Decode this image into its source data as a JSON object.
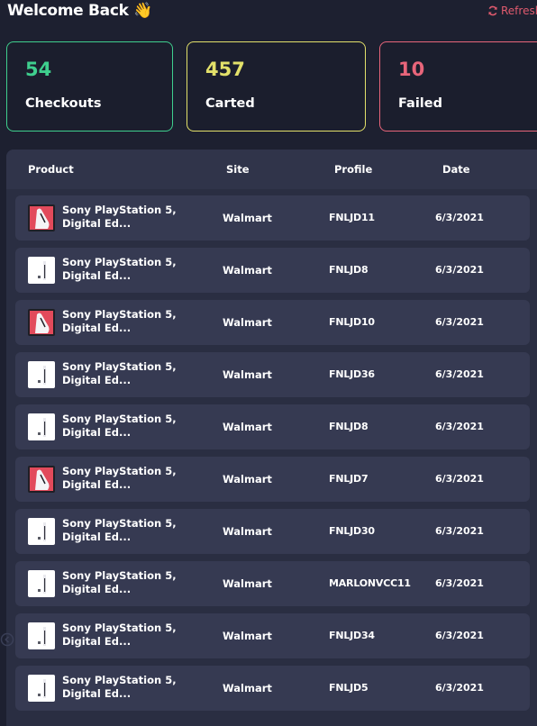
{
  "header": {
    "welcome": "Welcome Back 👋",
    "refresh_label": "Refresh",
    "refresh_icon": "refresh-icon"
  },
  "stats": {
    "checkouts": {
      "value": "54",
      "label": "Checkouts",
      "color": "#3fcf8e"
    },
    "carted": {
      "value": "457",
      "label": "Carted",
      "color": "#e3e16a"
    },
    "failed": {
      "value": "10",
      "label": "Failed",
      "color": "#e8657a"
    }
  },
  "table": {
    "columns": [
      "Product",
      "Site",
      "Profile",
      "Date"
    ],
    "rows": [
      {
        "product": "Sony PlayStation 5, Digital Ed...",
        "site": "Walmart",
        "profile": "FNLJD11",
        "date": "6/3/2021",
        "thumb": "red-console-thumb"
      },
      {
        "product": "Sony PlayStation 5, Digital Ed...",
        "site": "Walmart",
        "profile": "FNLJD8",
        "date": "6/3/2021",
        "thumb": "white-console-thumb"
      },
      {
        "product": "Sony PlayStation 5, Digital Ed...",
        "site": "Walmart",
        "profile": "FNLJD10",
        "date": "6/3/2021",
        "thumb": "red-console-thumb"
      },
      {
        "product": "Sony PlayStation 5, Digital Ed...",
        "site": "Walmart",
        "profile": "FNLJD36",
        "date": "6/3/2021",
        "thumb": "white-console-thumb"
      },
      {
        "product": "Sony PlayStation 5, Digital Ed...",
        "site": "Walmart",
        "profile": "FNLJD8",
        "date": "6/3/2021",
        "thumb": "white-console-thumb"
      },
      {
        "product": "Sony PlayStation 5, Digital Ed...",
        "site": "Walmart",
        "profile": "FNLJD7",
        "date": "6/3/2021",
        "thumb": "red-console-thumb"
      },
      {
        "product": "Sony PlayStation 5, Digital Ed...",
        "site": "Walmart",
        "profile": "FNLJD30",
        "date": "6/3/2021",
        "thumb": "white-console-thumb"
      },
      {
        "product": "Sony PlayStation 5, Digital Ed...",
        "site": "Walmart",
        "profile": "MARLONVCC11",
        "date": "6/3/2021",
        "thumb": "white-console-thumb"
      },
      {
        "product": "Sony PlayStation 5, Digital Ed...",
        "site": "Walmart",
        "profile": "FNLJD34",
        "date": "6/3/2021",
        "thumb": "white-console-thumb"
      },
      {
        "product": "Sony PlayStation 5, Digital Ed...",
        "site": "Walmart",
        "profile": "FNLJD5",
        "date": "6/3/2021",
        "thumb": "white-console-thumb"
      }
    ]
  },
  "nav": {
    "back_icon": "chevron-left-icon"
  }
}
